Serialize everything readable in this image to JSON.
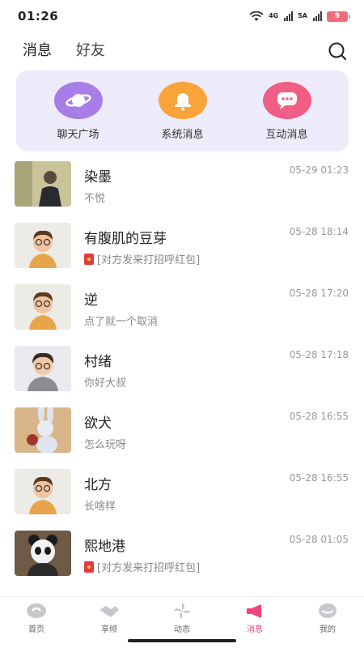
{
  "status_bar": {
    "time": "01:26",
    "network_1": "4G",
    "network_2": "5A",
    "battery": "9"
  },
  "header": {
    "tabs": [
      {
        "label": "消息"
      },
      {
        "label": "好友"
      }
    ]
  },
  "features": [
    {
      "label": "聊天广场",
      "icon": "planet-icon",
      "color": "#a77ee8"
    },
    {
      "label": "系统消息",
      "icon": "bell-icon",
      "color": "#f8a43a"
    },
    {
      "label": "互动消息",
      "icon": "chat-bubble-icon",
      "color": "#f05e85"
    }
  ],
  "messages": [
    {
      "name": "染墨",
      "preview": "不悦",
      "time": "05-29 01:23",
      "red_packet": false
    },
    {
      "name": "有腹肌的豆芽",
      "preview": "[对方发来打招呼红包]",
      "time": "05-28 18:14",
      "red_packet": true
    },
    {
      "name": "逆",
      "preview": "点了就一个取消",
      "time": "05-28 17:20",
      "red_packet": false
    },
    {
      "name": "村绪",
      "preview": "你好大叔",
      "time": "05-28 17:18",
      "red_packet": false
    },
    {
      "name": "欲犬",
      "preview": "怎么玩呀",
      "time": "05-28 16:55",
      "red_packet": false
    },
    {
      "name": "北方",
      "preview": "长啥样",
      "time": "05-28 16:55",
      "red_packet": false
    },
    {
      "name": "熙地港",
      "preview": "[对方发来打招呼红包]",
      "time": "05-28 01:05",
      "red_packet": true
    }
  ],
  "bottom_nav": [
    {
      "label": "首页",
      "icon": "home-icon"
    },
    {
      "label": "享倾",
      "icon": "handshake-icon"
    },
    {
      "label": "动态",
      "icon": "pinwheel-icon"
    },
    {
      "label": "消息",
      "icon": "megaphone-icon",
      "active": true
    },
    {
      "label": "我的",
      "icon": "profile-icon"
    }
  ],
  "colors": {
    "accent": "#f2457a",
    "card_bg": "#eeebfb",
    "tab_underline": "#f9a9c0"
  }
}
